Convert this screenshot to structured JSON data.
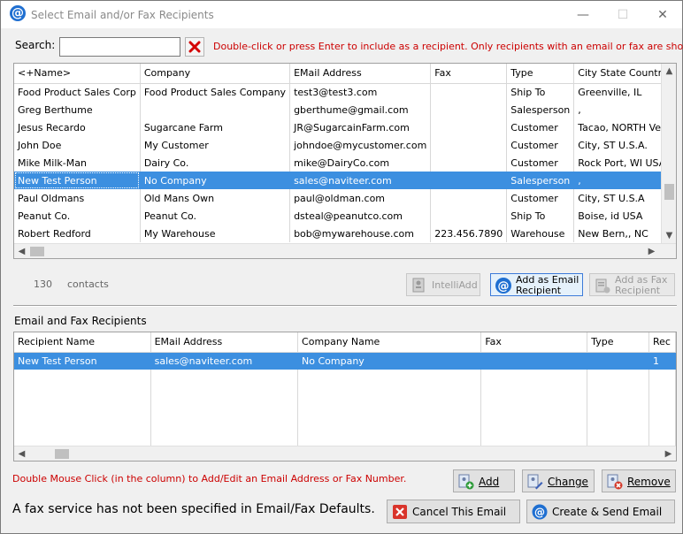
{
  "window": {
    "title": "Select Email and/or Fax Recipients",
    "minimize": "—",
    "maximize": "☐",
    "close": "✕"
  },
  "search": {
    "label": "Search:",
    "value": "",
    "placeholder": "",
    "hint": "Double-click or press Enter to include as a recipient.  Only recipients with an email or fax are shown."
  },
  "contacts": {
    "columns": [
      "<+Name>",
      "Company",
      "EMail Address",
      "Fax",
      "Type",
      "City State Country"
    ],
    "rows": [
      {
        "name": "Food Product Sales Corp",
        "company": "Food Product Sales Company",
        "email": "test3@test3.com",
        "fax": "",
        "type": "Ship To",
        "city": "Greenville, IL",
        "selected": false
      },
      {
        "name": "Greg Berthume",
        "company": "",
        "email": "gberthume@gmail.com",
        "fax": "",
        "type": "Salesperson",
        "city": ",",
        "selected": false
      },
      {
        "name": "Jesus Recardo",
        "company": "Sugarcane Farm",
        "email": "JR@SugarcainFarm.com",
        "fax": "",
        "type": "Customer",
        "city": "Tacao, NORTH Venezuela",
        "selected": false
      },
      {
        "name": "John Doe",
        "company": "My Customer",
        "email": "johndoe@mycustomer.com",
        "fax": "",
        "type": "Customer",
        "city": "City, ST U.S.A.",
        "selected": false
      },
      {
        "name": "Mike Milk-Man",
        "company": "Dairy Co.",
        "email": "mike@DairyCo.com",
        "fax": "",
        "type": "Customer",
        "city": "Rock Port, WI USA",
        "selected": false
      },
      {
        "name": "New Test Person",
        "company": "No Company",
        "email": "sales@naviteer.com",
        "fax": "",
        "type": "Salesperson",
        "city": ",",
        "selected": true
      },
      {
        "name": "Paul Oldmans",
        "company": "Old Mans Own",
        "email": "paul@oldman.com",
        "fax": "",
        "type": "Customer",
        "city": "City, ST U.S.A",
        "selected": false
      },
      {
        "name": "Peanut Co.",
        "company": "Peanut Co.",
        "email": "dsteal@peanutco.com",
        "fax": "",
        "type": "Ship To",
        "city": "Boise, id USA",
        "selected": false
      },
      {
        "name": "Robert Redford",
        "company": "My Warehouse",
        "email": "bob@mywarehouse.com",
        "fax": "223.456.7890",
        "type": "Warehouse",
        "city": "New Bern,, NC",
        "selected": false
      }
    ],
    "count": "130",
    "count_label": "contacts"
  },
  "actions": {
    "intelliadd": "IntelliAdd",
    "add_email_1": "Add as Email",
    "add_email_2": "Recipient",
    "add_fax_1": "Add as Fax",
    "add_fax_2": "Recipient"
  },
  "recipients": {
    "title": "Email and Fax Recipients",
    "columns": [
      "Recipient Name",
      "EMail Address",
      "Company Name",
      "Fax",
      "Type",
      "Rec"
    ],
    "rows": [
      {
        "name": "New Test Person",
        "email": "sales@naviteer.com",
        "company": "No Company",
        "fax": "",
        "type": "",
        "rec": "1",
        "selected": true
      }
    ]
  },
  "footer": {
    "hint": "Double Mouse Click (in the column) to Add/Edit an Email Address or Fax Number.",
    "add": "Add",
    "change": "Change",
    "remove": "Remove",
    "fax_message": "A fax service has not been specified in Email/Fax Defaults.",
    "cancel": "Cancel This Email",
    "create_send": "Create & Send Email"
  },
  "colors": {
    "selection": "#3c8fe0",
    "hint_red": "#cc0000",
    "accent_blue": "#1f6fd1"
  }
}
